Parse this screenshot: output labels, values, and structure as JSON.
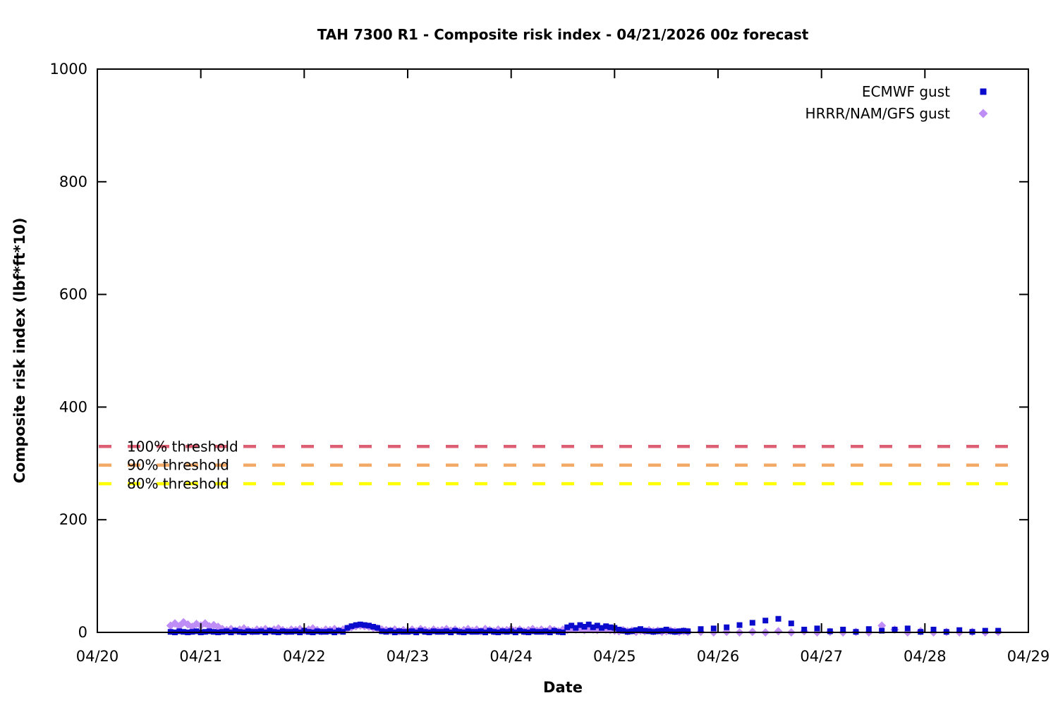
{
  "chart_data": {
    "type": "scatter",
    "title": "TAH 7300 R1 - Composite risk index - 04/21/2026 00z forecast",
    "xlabel": "Date",
    "ylabel": "Composite risk index (lbf*ft*10)",
    "x_axis": {
      "tick_labels": [
        "04/20",
        "04/21",
        "04/22",
        "04/23",
        "04/24",
        "04/25",
        "04/26",
        "04/27",
        "04/28",
        "04/29"
      ],
      "range_days": [
        0,
        9
      ],
      "x_unit": "days since 04/20 00z"
    },
    "y_axis": {
      "ticks": [
        0,
        200,
        400,
        600,
        800,
        1000
      ],
      "range": [
        0,
        1000
      ]
    },
    "grid": "off",
    "border_color": "#000000",
    "legend": {
      "position": "top-right-inside",
      "entries": [
        "ECMWF gust",
        "HRRR/NAM/GFS gust"
      ]
    },
    "thresholds": [
      {
        "label": "100% threshold",
        "value": 330,
        "color": "#dc5f74"
      },
      {
        "label": "90% threshold",
        "value": 297,
        "color": "#f4aa67"
      },
      {
        "label": "80% threshold",
        "value": 264,
        "color": "#ffff00"
      }
    ],
    "series": [
      {
        "name": "ECMWF gust",
        "marker": "square",
        "color": "#0a0acc",
        "points": [
          [
            0.708,
            1
          ],
          [
            0.75,
            0
          ],
          [
            0.792,
            2
          ],
          [
            0.833,
            1
          ],
          [
            0.875,
            0
          ],
          [
            0.917,
            1
          ],
          [
            0.958,
            2
          ],
          [
            1.0,
            0
          ],
          [
            1.042,
            1
          ],
          [
            1.083,
            2
          ],
          [
            1.125,
            1
          ],
          [
            1.167,
            0
          ],
          [
            1.208,
            1
          ],
          [
            1.25,
            2
          ],
          [
            1.292,
            0
          ],
          [
            1.333,
            3
          ],
          [
            1.375,
            1
          ],
          [
            1.417,
            0
          ],
          [
            1.458,
            2
          ],
          [
            1.5,
            1
          ],
          [
            1.542,
            1
          ],
          [
            1.583,
            2
          ],
          [
            1.625,
            0
          ],
          [
            1.667,
            3
          ],
          [
            1.708,
            1
          ],
          [
            1.75,
            0
          ],
          [
            1.792,
            2
          ],
          [
            1.833,
            1
          ],
          [
            1.875,
            1
          ],
          [
            1.917,
            2
          ],
          [
            1.958,
            0
          ],
          [
            2.0,
            3
          ],
          [
            2.042,
            1
          ],
          [
            2.083,
            0
          ],
          [
            2.125,
            2
          ],
          [
            2.167,
            1
          ],
          [
            2.208,
            1
          ],
          [
            2.25,
            2
          ],
          [
            2.292,
            0
          ],
          [
            2.333,
            3
          ],
          [
            2.375,
            1
          ],
          [
            2.417,
            8
          ],
          [
            2.458,
            11
          ],
          [
            2.5,
            13
          ],
          [
            2.542,
            14
          ],
          [
            2.583,
            13
          ],
          [
            2.625,
            12
          ],
          [
            2.667,
            10
          ],
          [
            2.708,
            8
          ],
          [
            2.75,
            2
          ],
          [
            2.792,
            1
          ],
          [
            2.833,
            3
          ],
          [
            2.875,
            0
          ],
          [
            2.917,
            2
          ],
          [
            2.958,
            1
          ],
          [
            3.0,
            1
          ],
          [
            3.042,
            2
          ],
          [
            3.083,
            0
          ],
          [
            3.125,
            3
          ],
          [
            3.167,
            1
          ],
          [
            3.208,
            0
          ],
          [
            3.25,
            2
          ],
          [
            3.292,
            1
          ],
          [
            3.333,
            1
          ],
          [
            3.375,
            2
          ],
          [
            3.417,
            0
          ],
          [
            3.458,
            3
          ],
          [
            3.5,
            1
          ],
          [
            3.542,
            0
          ],
          [
            3.583,
            2
          ],
          [
            3.625,
            1
          ],
          [
            3.667,
            1
          ],
          [
            3.708,
            2
          ],
          [
            3.75,
            0
          ],
          [
            3.792,
            3
          ],
          [
            3.833,
            1
          ],
          [
            3.875,
            0
          ],
          [
            3.917,
            2
          ],
          [
            3.958,
            1
          ],
          [
            4.0,
            2
          ],
          [
            4.042,
            0
          ],
          [
            4.083,
            3
          ],
          [
            4.125,
            1
          ],
          [
            4.167,
            0
          ],
          [
            4.208,
            2
          ],
          [
            4.25,
            1
          ],
          [
            4.292,
            1
          ],
          [
            4.333,
            2
          ],
          [
            4.375,
            0
          ],
          [
            4.417,
            3
          ],
          [
            4.458,
            1
          ],
          [
            4.5,
            0
          ],
          [
            4.542,
            9
          ],
          [
            4.583,
            12
          ],
          [
            4.625,
            8
          ],
          [
            4.667,
            13
          ],
          [
            4.708,
            10
          ],
          [
            4.75,
            14
          ],
          [
            4.792,
            9
          ],
          [
            4.833,
            12
          ],
          [
            4.875,
            8
          ],
          [
            4.917,
            11
          ],
          [
            4.958,
            9
          ],
          [
            5.0,
            8
          ],
          [
            5.042,
            5
          ],
          [
            5.083,
            3
          ],
          [
            5.125,
            1
          ],
          [
            5.167,
            2
          ],
          [
            5.208,
            4
          ],
          [
            5.25,
            6
          ],
          [
            5.292,
            3
          ],
          [
            5.333,
            2
          ],
          [
            5.375,
            1
          ],
          [
            5.417,
            2
          ],
          [
            5.458,
            3
          ],
          [
            5.5,
            5
          ],
          [
            5.542,
            2
          ],
          [
            5.583,
            1
          ],
          [
            5.625,
            2
          ],
          [
            5.667,
            3
          ],
          [
            5.708,
            2
          ],
          [
            5.833,
            6
          ],
          [
            5.958,
            7
          ],
          [
            6.083,
            9
          ],
          [
            6.208,
            13
          ],
          [
            6.333,
            17
          ],
          [
            6.458,
            21
          ],
          [
            6.583,
            24
          ],
          [
            6.708,
            16
          ],
          [
            6.833,
            5
          ],
          [
            6.958,
            7
          ],
          [
            7.083,
            2
          ],
          [
            7.208,
            5
          ],
          [
            7.333,
            1
          ],
          [
            7.458,
            6
          ],
          [
            7.583,
            3
          ],
          [
            7.708,
            5
          ],
          [
            7.833,
            7
          ],
          [
            7.958,
            1
          ],
          [
            8.083,
            5
          ],
          [
            8.208,
            1
          ],
          [
            8.333,
            4
          ],
          [
            8.458,
            1
          ],
          [
            8.583,
            3
          ],
          [
            8.708,
            3
          ]
        ]
      },
      {
        "name": "HRRR/NAM/GFS gust",
        "marker": "diamond",
        "color": "#bf8df6",
        "points": [
          [
            0.708,
            12
          ],
          [
            0.75,
            16
          ],
          [
            0.792,
            11
          ],
          [
            0.833,
            18
          ],
          [
            0.875,
            14
          ],
          [
            0.917,
            10
          ],
          [
            0.958,
            15
          ],
          [
            1.0,
            12
          ],
          [
            1.042,
            16
          ],
          [
            1.083,
            11
          ],
          [
            1.125,
            13
          ],
          [
            1.167,
            10
          ],
          [
            1.208,
            6
          ],
          [
            1.25,
            4
          ],
          [
            1.292,
            6
          ],
          [
            1.333,
            3
          ],
          [
            1.375,
            5
          ],
          [
            1.417,
            7
          ],
          [
            1.458,
            4
          ],
          [
            1.5,
            2
          ],
          [
            1.542,
            5
          ],
          [
            1.583,
            4
          ],
          [
            1.625,
            6
          ],
          [
            1.667,
            3
          ],
          [
            1.708,
            5
          ],
          [
            1.75,
            7
          ],
          [
            1.792,
            4
          ],
          [
            1.833,
            2
          ],
          [
            1.875,
            5
          ],
          [
            1.917,
            4
          ],
          [
            1.958,
            6
          ],
          [
            2.0,
            3
          ],
          [
            2.042,
            5
          ],
          [
            2.083,
            7
          ],
          [
            2.125,
            4
          ],
          [
            2.167,
            2
          ],
          [
            2.208,
            5
          ],
          [
            2.25,
            4
          ],
          [
            2.292,
            6
          ],
          [
            2.333,
            3
          ],
          [
            2.375,
            5
          ],
          [
            2.417,
            7
          ],
          [
            2.458,
            9
          ],
          [
            2.5,
            11
          ],
          [
            2.542,
            12
          ],
          [
            2.583,
            11
          ],
          [
            2.625,
            10
          ],
          [
            2.667,
            8
          ],
          [
            2.708,
            7
          ],
          [
            2.75,
            5
          ],
          [
            2.792,
            4
          ],
          [
            2.833,
            3
          ],
          [
            2.875,
            5
          ],
          [
            2.917,
            2
          ],
          [
            2.958,
            4
          ],
          [
            3.0,
            3
          ],
          [
            3.042,
            5
          ],
          [
            3.083,
            2
          ],
          [
            3.125,
            6
          ],
          [
            3.167,
            4
          ],
          [
            3.208,
            2
          ],
          [
            3.25,
            5
          ],
          [
            3.292,
            3
          ],
          [
            3.333,
            4
          ],
          [
            3.375,
            6
          ],
          [
            3.417,
            3
          ],
          [
            3.458,
            5
          ],
          [
            3.5,
            2
          ],
          [
            3.542,
            4
          ],
          [
            3.583,
            6
          ],
          [
            3.625,
            3
          ],
          [
            3.667,
            5
          ],
          [
            3.708,
            2
          ],
          [
            3.75,
            6
          ],
          [
            3.792,
            4
          ],
          [
            3.833,
            2
          ],
          [
            3.875,
            5
          ],
          [
            3.917,
            3
          ],
          [
            3.958,
            4
          ],
          [
            4.0,
            6
          ],
          [
            4.042,
            3
          ],
          [
            4.083,
            5
          ],
          [
            4.125,
            2
          ],
          [
            4.167,
            4
          ],
          [
            4.208,
            6
          ],
          [
            4.25,
            3
          ],
          [
            4.292,
            5
          ],
          [
            4.333,
            2
          ],
          [
            4.375,
            6
          ],
          [
            4.417,
            4
          ],
          [
            4.458,
            2
          ],
          [
            4.5,
            5
          ],
          [
            4.542,
            4
          ],
          [
            4.583,
            6
          ],
          [
            4.625,
            5
          ],
          [
            4.667,
            7
          ],
          [
            4.708,
            4
          ],
          [
            4.75,
            6
          ],
          [
            4.792,
            5
          ],
          [
            4.833,
            4
          ],
          [
            4.875,
            6
          ],
          [
            4.917,
            5
          ],
          [
            4.958,
            4
          ],
          [
            5.0,
            3
          ],
          [
            5.042,
            2
          ],
          [
            5.083,
            4
          ],
          [
            5.125,
            2
          ],
          [
            5.167,
            3
          ],
          [
            5.208,
            1
          ],
          [
            5.25,
            3
          ],
          [
            5.292,
            2
          ],
          [
            5.333,
            4
          ],
          [
            5.375,
            2
          ],
          [
            5.417,
            3
          ],
          [
            5.458,
            1
          ],
          [
            5.5,
            2
          ],
          [
            5.542,
            3
          ],
          [
            5.583,
            2
          ],
          [
            5.625,
            1
          ],
          [
            5.667,
            2
          ],
          [
            5.708,
            1
          ],
          [
            5.833,
            1
          ],
          [
            5.958,
            0
          ],
          [
            6.083,
            1
          ],
          [
            6.208,
            0
          ],
          [
            6.333,
            1
          ],
          [
            6.458,
            0
          ],
          [
            6.583,
            2
          ],
          [
            6.708,
            0
          ],
          [
            6.833,
            2
          ],
          [
            6.958,
            0
          ],
          [
            7.083,
            1
          ],
          [
            7.208,
            0
          ],
          [
            7.333,
            1
          ],
          [
            7.458,
            0
          ],
          [
            7.583,
            12
          ],
          [
            7.708,
            5
          ],
          [
            7.833,
            0
          ],
          [
            7.958,
            2
          ],
          [
            8.083,
            0
          ],
          [
            8.208,
            1
          ],
          [
            8.333,
            0
          ],
          [
            8.458,
            1
          ],
          [
            8.583,
            0
          ],
          [
            8.708,
            1
          ]
        ]
      }
    ]
  }
}
